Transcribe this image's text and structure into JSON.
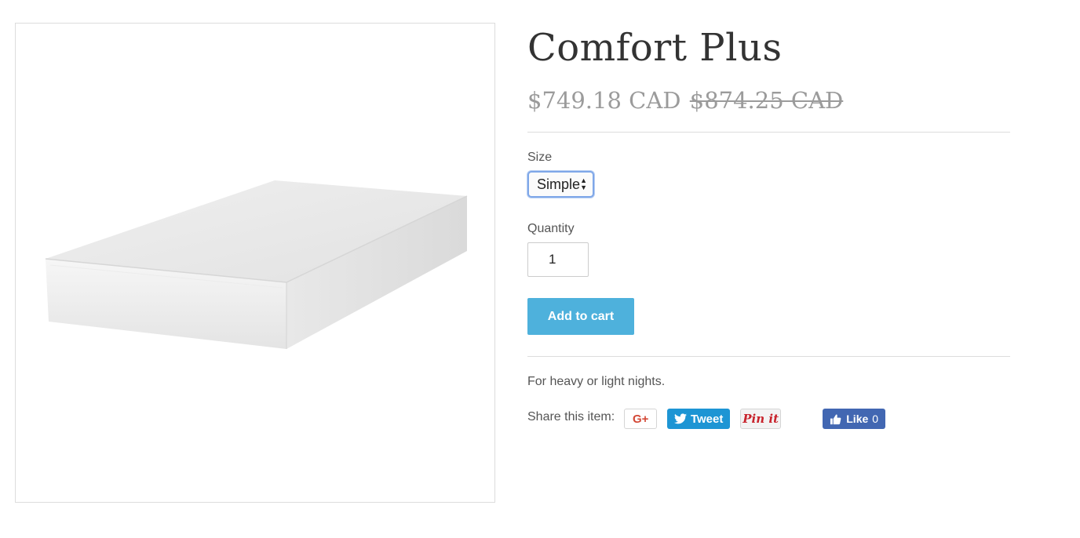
{
  "product": {
    "title": "Comfort Plus",
    "price": "$749.18 CAD",
    "compare_price": "$874.25 CAD",
    "description": "For heavy or light nights.",
    "image_alt": "mattress-photo"
  },
  "options": {
    "size_label": "Size",
    "size_selected": "Simple",
    "quantity_label": "Quantity",
    "quantity_value": "1"
  },
  "cart": {
    "add_label": "Add to cart"
  },
  "share": {
    "label": "Share this item:",
    "gplus_label": "G+",
    "tweet_label": "Tweet",
    "pin_label": "Pin it",
    "like_label": "Like",
    "like_count": "0"
  },
  "colors": {
    "accent_button": "#4eb1dc",
    "price_gray": "#9b9b9b",
    "tweet_blue": "#1d95d4",
    "facebook_blue": "#4267b2",
    "pinterest_red": "#c8232c",
    "gplus_red": "#d34836"
  },
  "icons": {
    "tweet": "twitter-bird-icon",
    "like": "thumbs-up-icon",
    "select": "updown-arrows-icon"
  }
}
